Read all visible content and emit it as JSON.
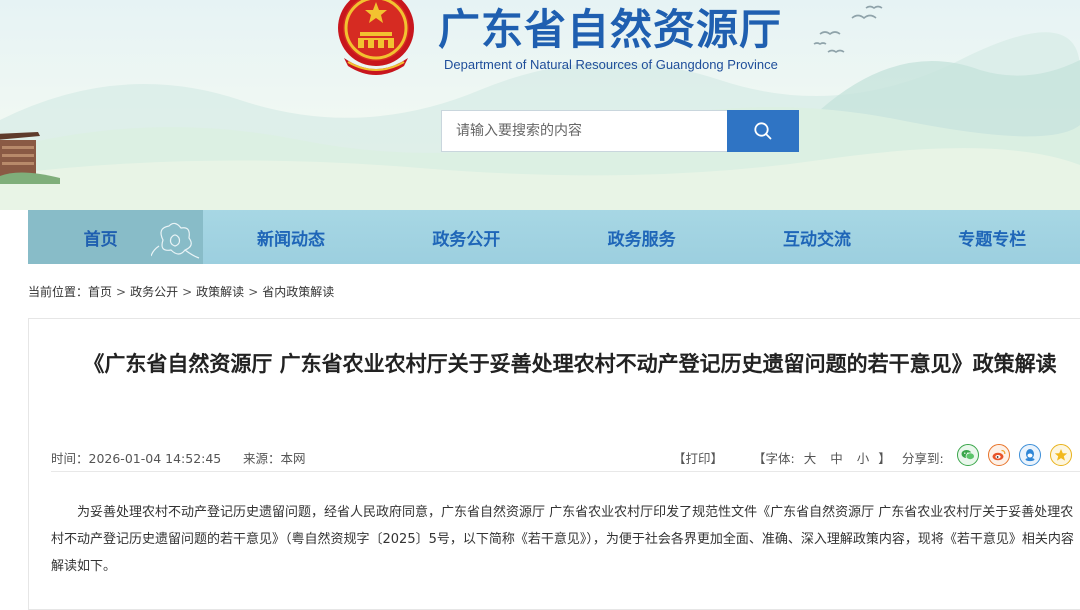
{
  "header": {
    "site_title": "广东省自然资源厅",
    "site_subtitle": "Department of Natural Resources of Guangdong Province",
    "search_placeholder": "请输入要搜索的内容"
  },
  "nav": {
    "items": [
      {
        "label": "首页",
        "active": true
      },
      {
        "label": "新闻动态"
      },
      {
        "label": "政务公开"
      },
      {
        "label": "政务服务"
      },
      {
        "label": "互动交流"
      },
      {
        "label": "专题专栏"
      }
    ]
  },
  "breadcrumb": {
    "prefix": "当前位置：",
    "items": [
      "首页",
      "政务公开",
      "政策解读",
      "省内政策解读"
    ],
    "separator": ">"
  },
  "article": {
    "title": "《广东省自然资源厅 广东省农业农村厅关于妥善处理农村不动产登记历史遗留问题的若干意见》政策解读",
    "time": "时间：2026-01-04 14:52:45",
    "source": "来源：本网",
    "print_label": "【打印】",
    "font_label_open": "【字体:",
    "font_large": "大",
    "font_medium": "中",
    "font_small": "小",
    "font_label_close": "】",
    "share_label": "分享到:",
    "share_icons": [
      "wechat-icon",
      "weibo-icon",
      "qq-icon",
      "qzone-icon"
    ],
    "body": "为妥善处理农村不动产登记历史遗留问题，经省人民政府同意，广东省自然资源厅 广东省农业农村厅印发了规范性文件《广东省自然资源厅 广东省农业农村厅关于妥善处理农村不动产登记历史遗留问题的若干意见》（粤自然资规字〔2025〕5号，以下简称《若干意见》），为便于社会各界更加全面、准确、深入理解政策内容，现将《若干意见》相关内容解读如下。"
  },
  "colors": {
    "brand_blue": "#1f5fb0",
    "nav_bg": "#a7d7e4",
    "nav_active_bg": "#88bcc8",
    "search_button": "#2f74c4"
  }
}
